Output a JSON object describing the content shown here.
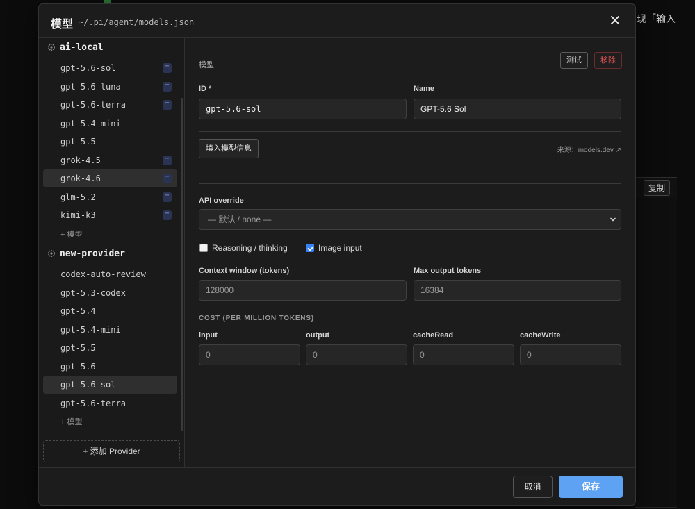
{
  "background": {
    "partial_text": "现「输入",
    "copy_label": "复制"
  },
  "modal": {
    "title": "模型",
    "path": "~/.pi/agent/models.json"
  },
  "sidebar": {
    "providers": [
      {
        "name": "ai-local",
        "models": [
          {
            "id": "gpt-5.6-sol",
            "badge": "T"
          },
          {
            "id": "gpt-5.6-luna",
            "badge": "T"
          },
          {
            "id": "gpt-5.6-terra",
            "badge": "T"
          },
          {
            "id": "gpt-5.4-mini",
            "badge": ""
          },
          {
            "id": "gpt-5.5",
            "badge": ""
          },
          {
            "id": "grok-4.5",
            "badge": "T"
          },
          {
            "id": "grok-4.6",
            "badge": "T"
          },
          {
            "id": "glm-5.2",
            "badge": "T"
          },
          {
            "id": "kimi-k3",
            "badge": "T"
          }
        ],
        "add_model_label": "+ 模型"
      },
      {
        "name": "new-provider",
        "models": [
          {
            "id": "codex-auto-review",
            "badge": ""
          },
          {
            "id": "gpt-5.3-codex",
            "badge": ""
          },
          {
            "id": "gpt-5.4",
            "badge": ""
          },
          {
            "id": "gpt-5.4-mini",
            "badge": ""
          },
          {
            "id": "gpt-5.5",
            "badge": ""
          },
          {
            "id": "gpt-5.6",
            "badge": ""
          },
          {
            "id": "gpt-5.6-sol",
            "badge": ""
          },
          {
            "id": "gpt-5.6-terra",
            "badge": ""
          }
        ],
        "add_model_label": "+ 模型"
      }
    ],
    "add_provider_label": "+ 添加 Provider"
  },
  "editor": {
    "section_label": "模型",
    "test_label": "测试",
    "remove_label": "移除",
    "id_label": "ID *",
    "id_value": "gpt-5.6-sol",
    "name_label": "Name",
    "name_value": "GPT-5.6 Sol",
    "fill_info_label": "填入模型信息",
    "source_label": "来源：models.dev ↗",
    "api_override_label": "API override",
    "api_override_value": "— 默认 / none —",
    "reasoning_label": "Reasoning / thinking",
    "reasoning_checked": false,
    "image_input_label": "Image input",
    "image_input_checked": true,
    "context_window_label": "Context window (tokens)",
    "context_window_value": "128000",
    "max_output_label": "Max output tokens",
    "max_output_value": "16384",
    "cost_heading": "COST (PER MILLION TOKENS)",
    "cost": [
      {
        "label": "input",
        "value": "0"
      },
      {
        "label": "output",
        "value": "0"
      },
      {
        "label": "cacheRead",
        "value": "0"
      },
      {
        "label": "cacheWrite",
        "value": "0"
      }
    ]
  },
  "footer": {
    "cancel_label": "取消",
    "save_label": "保存"
  },
  "colors": {
    "accent": "#5ea2f3",
    "danger": "#e05252",
    "badge_bg": "#2a3452"
  }
}
